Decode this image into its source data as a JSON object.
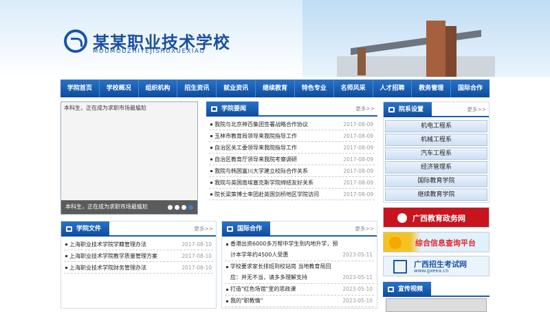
{
  "header": {
    "title": "某某职业技术学校",
    "subtitle": "MOUMOUZHIYEJISHUXUEXIAO"
  },
  "nav": [
    "学院首页",
    "学校概况",
    "组织机构",
    "招生资讯",
    "就业资讯",
    "继续教育",
    "特色专业",
    "名师风采",
    "人才招聘",
    "教务管理",
    "国际合作"
  ],
  "slideshow": {
    "alt_text": "本科生，正在成为求职市场最尴尬",
    "caption": "本科生，正在成为求职市场最尴尬",
    "dots": 4,
    "active_dot": 3
  },
  "news": {
    "title": "学院要闻",
    "more": "更多>>",
    "items": [
      {
        "text": "我院与北京神百集团签署战略合作协议",
        "date": "2017-08-09"
      },
      {
        "text": "玉林市教育局领导来我院指导工作",
        "date": "2017-08-09"
      },
      {
        "text": "自治区关工委领导来我院指导工作",
        "date": "2017-08-09"
      },
      {
        "text": "自治区教育厅领导来我院考察调研",
        "date": "2017-08-09"
      },
      {
        "text": "我院与韩国富川大学建立校际合作关系",
        "date": "2017-08-09"
      },
      {
        "text": "我院与英国南埃塞克斯学院缔结友好关系",
        "date": "2017-08-09"
      },
      {
        "text": "院长梁策博士率团赴英国剑桥地区学院访问",
        "date": "2017-08-09"
      }
    ]
  },
  "departments": {
    "title": "院系设置",
    "more": "更多>>",
    "items": [
      "机电工程系",
      "机械工程系",
      "汽车工程系",
      "经济管理系",
      "国际教育学院",
      "继续教育学院"
    ]
  },
  "docs": {
    "title": "学院文件",
    "more": "更多>>",
    "items": [
      {
        "text": "上海职业技术学院学籍管理办法",
        "date": "2017-08-10"
      },
      {
        "text": "上海职业技术学院教学质量管理方案",
        "date": "2017-08-10"
      },
      {
        "text": "上海职业技术学院财务管理办法",
        "date": "2017-08-10"
      }
    ]
  },
  "intl": {
    "title": "国际合作",
    "more": "更多>>",
    "items": [
      {
        "text": "香港出资6000多万帮中学生到内地升学，预计本学年约4500人受惠",
        "date": "2023-05-11"
      },
      {
        "text": "学校要求家长排班到校站岗 当地教育局回应：并无不当，请多多理解支持",
        "date": "2023-05-11"
      },
      {
        "text": "打造\"红色场馆\"里的思政课",
        "date": "2023-05-10"
      },
      {
        "text": "我的\"职教情\"",
        "date": "2023-05-10"
      }
    ]
  },
  "banners": [
    {
      "text": "广西教育政务网",
      "color": "#ffffff",
      "bg": "#c8141e"
    },
    {
      "text": "综合信息查询平台",
      "color": "#e6262a",
      "bg": "#dff1fb"
    },
    {
      "text": "广西招生考试网",
      "color": "#1a56a8",
      "bg": "#eaf4fc"
    }
  ],
  "banner_urls": [
    "",
    "",
    "www.gxeea.cn"
  ],
  "video": {
    "title": "宣传视频"
  }
}
